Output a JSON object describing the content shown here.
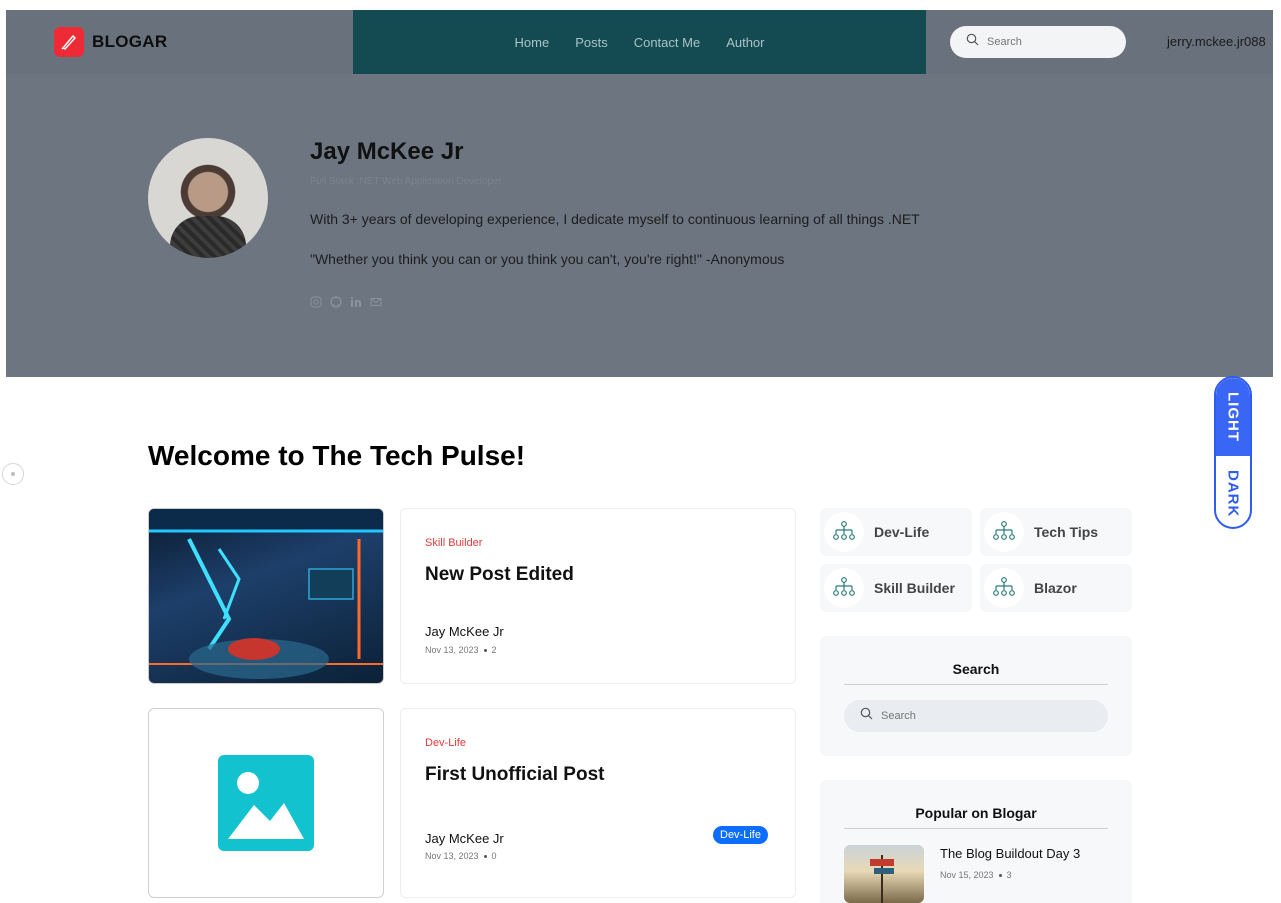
{
  "header": {
    "brand": "BLOGAR",
    "nav": [
      "Home",
      "Posts",
      "Contact Me",
      "Author"
    ],
    "search_placeholder": "Search",
    "user_email": "jerry.mckee.jr088"
  },
  "author": {
    "name": "Jay McKee Jr",
    "role": "Full Stack .NET Web Application Developer",
    "bio": "With 3+ years of developing experience, I dedicate myself to continuous learning of all things .NET",
    "quote": "\"Whether you think you can or you think you can't, you're right!\" -Anonymous",
    "socials": [
      "instagram-icon",
      "github-icon",
      "linkedin-icon",
      "mail-icon"
    ]
  },
  "main": {
    "welcome": "Welcome to The Tech Pulse!"
  },
  "posts": [
    {
      "category": "Skill Builder",
      "title": "New Post Edited",
      "author": "Jay McKee Jr",
      "date": "Nov 13, 2023",
      "count": "2"
    },
    {
      "category": "Dev-Life",
      "title": "First Unofficial Post",
      "author": "Jay McKee Jr",
      "date": "Nov 13, 2023",
      "count": "0",
      "tag": "Dev-Life"
    }
  ],
  "categories": [
    "Dev-Life",
    "Tech Tips",
    "Skill Builder",
    "Blazor"
  ],
  "sidebar": {
    "search_title": "Search",
    "search_placeholder": "Search",
    "popular_title": "Popular on Blogar",
    "popular": [
      {
        "title": "The Blog Buildout Day 3",
        "date": "Nov 15, 2023",
        "count": "3"
      }
    ]
  },
  "theme_toggle": {
    "light": "LIGHT",
    "dark": "DARK"
  },
  "colors": {
    "accent_red": "#e33a3a",
    "nav_bg": "#144b52",
    "toggle_blue": "#3a66f5",
    "tag_blue": "#0d6efd"
  }
}
